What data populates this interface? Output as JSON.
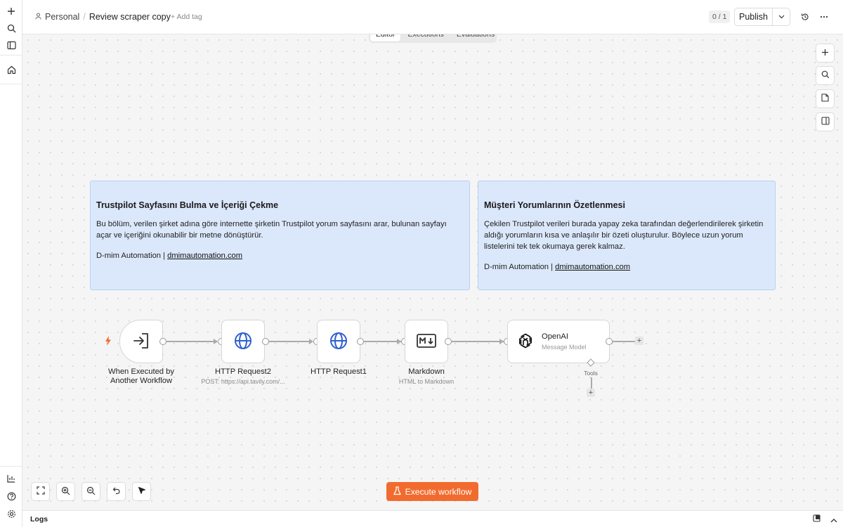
{
  "breadcrumb": {
    "project": "Personal",
    "workflow_name": "Review scraper copy",
    "add_tag": "+ Add tag"
  },
  "header": {
    "version_counter": "0 / 1",
    "publish_label": "Publish"
  },
  "tabs": [
    {
      "label": "Editor",
      "active": true
    },
    {
      "label": "Executions",
      "active": false
    },
    {
      "label": "Evaluations",
      "active": false
    }
  ],
  "notes": [
    {
      "title": "Trustpilot Sayfasını Bulma ve İçeriği Çekme",
      "body": "Bu bölüm, verilen şirket adına göre internette şirketin Trustpilot yorum sayfasını arar, bulunan sayfayı açar ve içeriğini okunabilir bir metne dönüştürür.",
      "footer_text": "D-mim Automation | ",
      "footer_link": "dmimautomation.com"
    },
    {
      "title": "Müşteri Yorumlarının Özetlenmesi",
      "body": "Çekilen Trustpilot verileri burada yapay zeka tarafından değerlendirilerek şirketin aldığı yorumların kısa ve anlaşılır bir özeti oluşturulur. Böylece uzun yorum listelerini tek tek okumaya gerek kalmaz.",
      "footer_text": "D-mim Automation | ",
      "footer_link": "dmimautomation.com"
    }
  ],
  "nodes": {
    "trigger": {
      "title": "When Executed by Another Workflow",
      "icon": "sign-in-icon"
    },
    "http2": {
      "title": "HTTP Request2",
      "subtitle": "POST: https://api.tavily.com/...",
      "icon": "globe-icon"
    },
    "http1": {
      "title": "HTTP Request1",
      "icon": "globe-icon"
    },
    "markdown": {
      "title": "Markdown",
      "subtitle": "HTML to Markdown",
      "icon": "markdown-icon"
    },
    "openai": {
      "title": "OpenAI",
      "subtitle": "Message Model",
      "tools_label": "Tools",
      "icon": "openai-icon"
    }
  },
  "execute_label": "Execute workflow",
  "logs_label": "Logs",
  "colors": {
    "accent": "#f26b2e",
    "note_bg": "#dbe8fb",
    "note_border": "#b9d0f0",
    "canvas_bg": "#f5f5f5",
    "trigger_bolt": "#f26b2e"
  }
}
